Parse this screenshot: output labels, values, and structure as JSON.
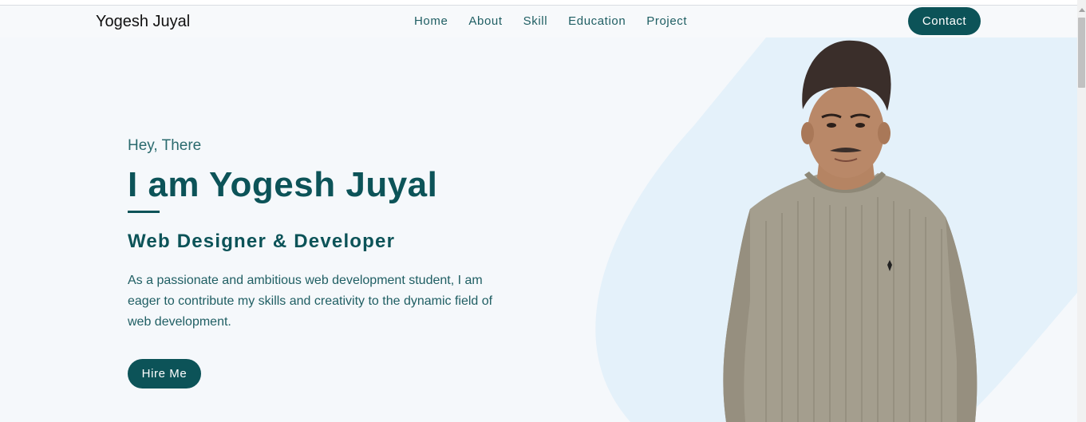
{
  "nav": {
    "brand": "Yogesh Juyal",
    "links": [
      "Home",
      "About",
      "Skill",
      "Education",
      "Project"
    ],
    "contact_label": "Contact"
  },
  "hero": {
    "greeting": "Hey, There",
    "name": "I am Yogesh Juyal",
    "role": "Web Designer & Developer",
    "description": "As a passionate and ambitious web development student, I am eager to contribute my skills and creativity to the dynamic field of web development.",
    "hire_label": "Hire Me"
  },
  "colors": {
    "primary": "#0c5358",
    "text_teal": "#1f5e63",
    "background": "#f5f8fb",
    "shape": "#e4f1fa",
    "sweater": "#a49e8e"
  },
  "icons": {
    "scroll_up": "chevron-up-icon"
  }
}
